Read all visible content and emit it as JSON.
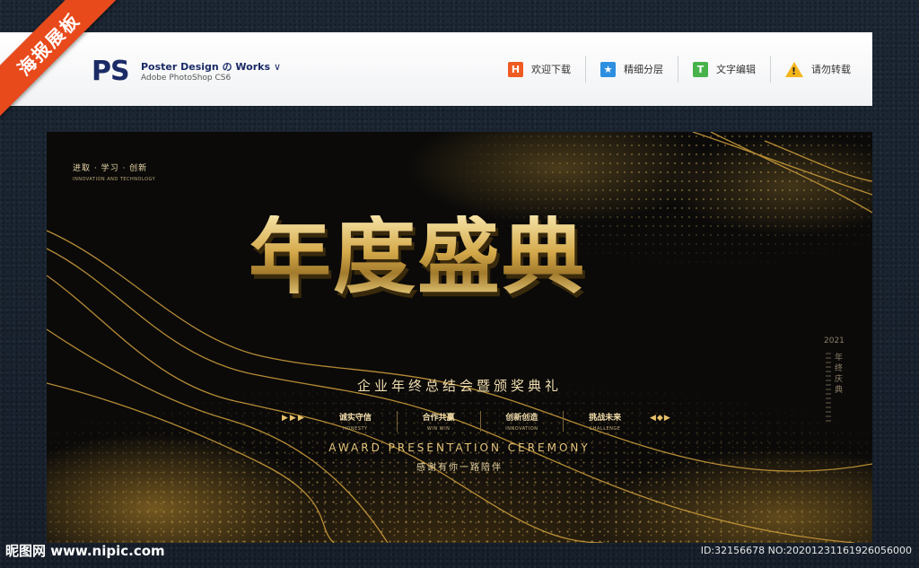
{
  "ribbon": {
    "label": "海报展板"
  },
  "header": {
    "logo": "PS",
    "title": "Poster Design の Works",
    "title_chevron": "∨",
    "subtitle": "Adobe PhotoShop CS6",
    "tools": [
      {
        "icon": "H",
        "label": "欢迎下载"
      },
      {
        "icon": "★",
        "label": "精细分层"
      },
      {
        "icon": "T",
        "label": "文字编辑"
      },
      {
        "icon": "!",
        "label": "请勿转载"
      }
    ]
  },
  "poster": {
    "corner": {
      "cn": "进取 · 学习 · 创新",
      "en": "INNOVATION AND TECHNOLOGY"
    },
    "title": "年度盛典",
    "subtitle": "企业年终总结会暨颁奖典礼",
    "arrows_left": "▶▶▶",
    "arrows_right": "◀◆▶",
    "pillars": [
      {
        "cn": "诚实守信",
        "en": "HONESTY"
      },
      {
        "cn": "合作共赢",
        "en": "WIN WIN"
      },
      {
        "cn": "创新创造",
        "en": "INNOVATION"
      },
      {
        "cn": "挑战未来",
        "en": "CHALLENGE"
      }
    ],
    "ceremony": "AWARD PRESENTATION CEREMONY",
    "thanks": "感谢有你一路陪伴",
    "side_year": "2021",
    "side_text": "年终庆典"
  },
  "footer": {
    "site": "昵图网 www.nipic.com",
    "id": "ID:32156678 NO:20201231161926056000"
  }
}
